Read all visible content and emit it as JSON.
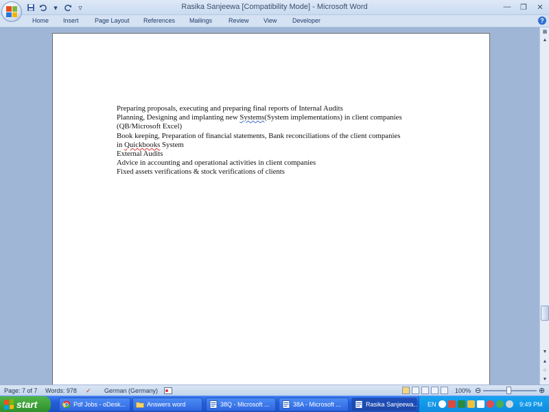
{
  "window": {
    "title": "Rasika Sanjeewa [Compatibility Mode] - Microsoft Word"
  },
  "ribbon": {
    "tabs": [
      "Home",
      "Insert",
      "Page Layout",
      "References",
      "Mailings",
      "Review",
      "View",
      "Developer"
    ]
  },
  "document": {
    "lines": [
      "Preparing proposals, executing and preparing final reports of Internal Audits",
      "Planning, Designing and implanting new Systems(System implementations) in client companies",
      "(QB/Microsoft Excel)",
      "Book keeping, Preparation of financial statements, Bank reconciliations of the client companies",
      "in Quickbooks System",
      "External Audits",
      "Advice in accounting and operational activities in client companies",
      "Fixed assets verifications & stock verifications of clients"
    ],
    "line2_pre": "Planning, Designing and implanting new ",
    "line2_flag": "Systems",
    "line2_post": "(System implementations) in client companies",
    "line5_pre": "in ",
    "line5_flag": "Quickbooks",
    "line5_post": " System"
  },
  "statusbar": {
    "page": "Page: 7 of 7",
    "words": "Words: 978",
    "language": "German (Germany)",
    "zoom": "100%",
    "zoom_level": 1.0
  },
  "taskbar": {
    "start": "start",
    "tasks": [
      "Pdf Jobs - oDesk...",
      "Answers word",
      "38Q - Microsoft ...",
      "38A - Microsoft ...",
      "Rasika Sanjeewa..."
    ],
    "lang": "EN",
    "clock": "9:49 PM"
  },
  "colors": {
    "taskbar_blue": "#245edb",
    "start_green": "#2f8e2b",
    "tray_blue": "#0f8ae0",
    "spell_red": "#d42b2b",
    "grammar_blue": "#3b66c8"
  },
  "icons": [
    "office-button-icon",
    "save-icon",
    "undo-icon",
    "redo-icon",
    "customize-qat-icon",
    "minimize-icon",
    "maximize-icon",
    "close-icon",
    "help-icon",
    "proofing-icon",
    "macro-icon"
  ]
}
